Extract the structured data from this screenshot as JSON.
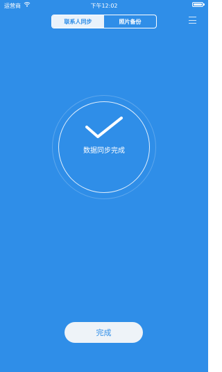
{
  "status_bar": {
    "carrier": "运营商",
    "time": "下午12:02",
    "wifi_icon": "wifi-icon",
    "battery_icon": "battery-icon"
  },
  "tabs": [
    {
      "label": "联系人同步",
      "active": true
    },
    {
      "label": "照片备份",
      "active": false
    }
  ],
  "menu_icon": "hamburger-menu-icon",
  "status": {
    "icon": "checkmark-icon",
    "text": "数据同步完成"
  },
  "finish_button": {
    "label": "完成"
  },
  "colors": {
    "background": "#2f8ee8",
    "active_tab_bg": "#e9f2fb",
    "button_bg": "#eef3f8",
    "accent_text": "#2f8ee8"
  }
}
